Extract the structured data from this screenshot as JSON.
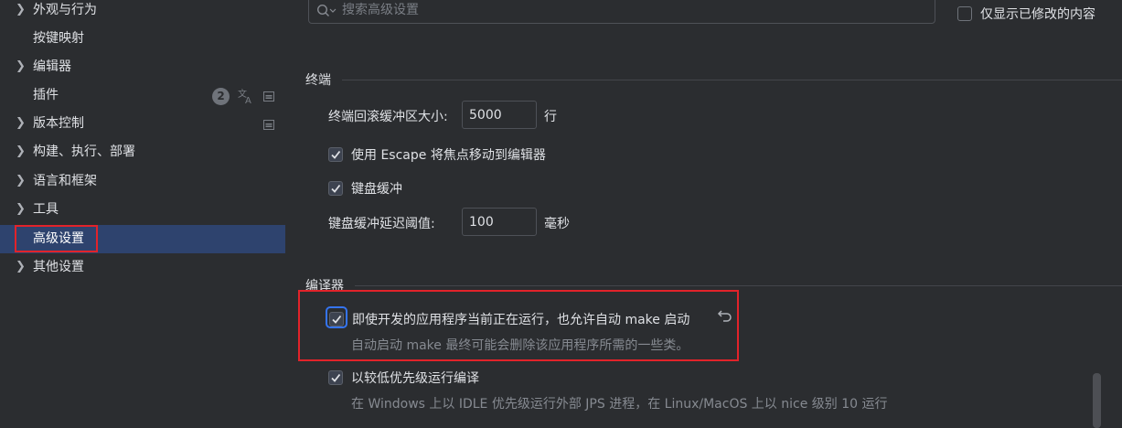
{
  "sidebar": {
    "items": [
      {
        "label": "外观与行为",
        "chevron": true
      },
      {
        "label": "按键映射",
        "chevron": false
      },
      {
        "label": "编辑器",
        "chevron": true
      },
      {
        "label": "插件",
        "chevron": false,
        "badge": "2"
      },
      {
        "label": "版本控制",
        "chevron": true
      },
      {
        "label": "构建、执行、部署",
        "chevron": true
      },
      {
        "label": "语言和框架",
        "chevron": true
      },
      {
        "label": "工具",
        "chevron": true
      },
      {
        "label": "高级设置",
        "chevron": false,
        "selected": true
      },
      {
        "label": "其他设置",
        "chevron": true
      }
    ],
    "icons": [
      "chevron-right-icon",
      "translate-icon",
      "settings-page-icon"
    ]
  },
  "search": {
    "placeholder": "搜索高级设置",
    "value": "",
    "modified_only_label": "仅显示已修改的内容",
    "modified_only_checked": false
  },
  "terminal": {
    "title": "终端",
    "scrollback_label": "终端回滚缓冲区大小:",
    "scrollback_value": "5000",
    "scrollback_unit": "行",
    "escape_label": "使用 Escape 将焦点移动到编辑器",
    "escape_checked": true,
    "typeahead_label": "键盘缓冲",
    "typeahead_checked": true,
    "typeahead_delay_label": "键盘缓冲延迟阈值:",
    "typeahead_delay_value": "100",
    "typeahead_delay_unit": "毫秒"
  },
  "compiler": {
    "title": "编译器",
    "auto_make_label": "即使开发的应用程序当前正在运行，也允许自动 make 启动",
    "auto_make_checked": true,
    "auto_make_hint": "自动启动 make 最终可能会删除该应用程序所需的一些类。",
    "low_priority_label": "以较低优先级运行编译",
    "low_priority_checked": true,
    "low_priority_hint": "在 Windows 上以 IDLE 优先级运行外部 JPS 进程，在 Linux/MacOS 上以 nice 级别 10 运行"
  },
  "colors": {
    "background": "#2b2d30",
    "selection": "#2e436e",
    "annotation_red": "#e2232a",
    "focus_blue": "#3574f0"
  }
}
